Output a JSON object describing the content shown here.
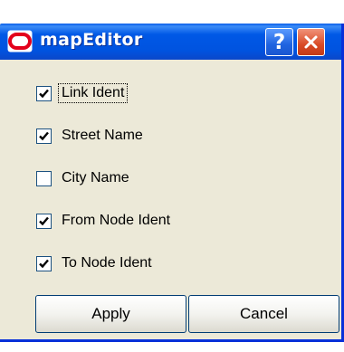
{
  "window": {
    "title": "mapEditor"
  },
  "titlebar_buttons": {
    "help": "?"
  },
  "options": [
    {
      "label": "Link Ident",
      "checked": true
    },
    {
      "label": "Street Name",
      "checked": true
    },
    {
      "label": "City Name",
      "checked": false
    },
    {
      "label": "From Node Ident",
      "checked": true
    },
    {
      "label": "To Node Ident",
      "checked": true
    }
  ],
  "buttons": {
    "apply": "Apply",
    "cancel": "Cancel"
  },
  "colors": {
    "titlebar": "#0058e6",
    "dialog_background": "#ece9d8",
    "close_button": "#d94b27"
  }
}
